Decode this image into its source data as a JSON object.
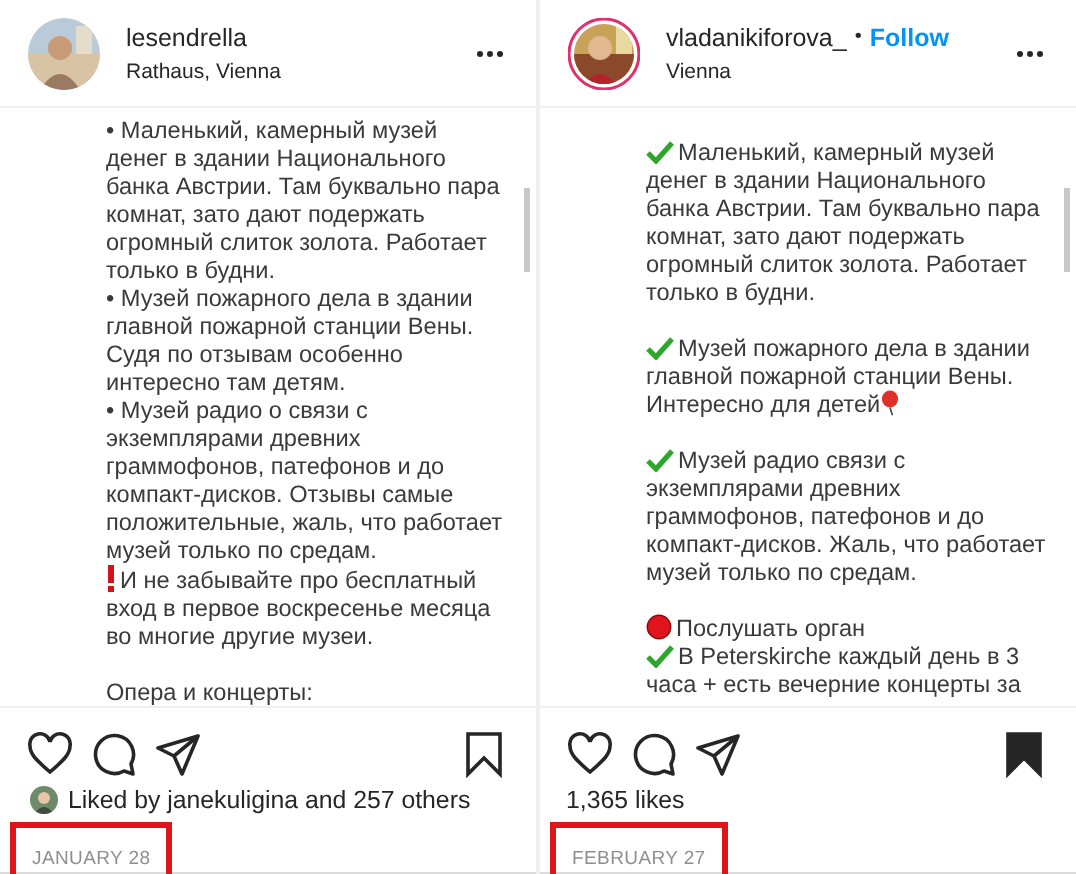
{
  "posts": [
    {
      "username": "lesendrella",
      "location": "Rathaus, Vienna",
      "saved": false,
      "liked_by": "Liked by janekuligina and 257 others",
      "date": "JANUARY 28",
      "date_highlighted": true,
      "caption": [
        [
          {
            "kind": "plain",
            "lines": [
              "• Маленький, камерный музей",
              "денег в здании Национального",
              "банка Австрии. Там буквально пара",
              "комнат, зато дают подержать",
              "огромный слиток золота. Работает",
              "только в будни."
            ]
          },
          {
            "kind": "plain",
            "lines": [
              "• Музей пожарного дела в здании",
              "главной пожарной станции Вены.",
              "Судя по отзывам особенно",
              "интересно там детям."
            ]
          },
          {
            "kind": "plain",
            "lines": [
              "• Музей радио о связи с",
              "экземплярами древних",
              "граммофонов, патефонов и до",
              "компакт-дисков. Отзывы самые",
              "положительные, жаль, что работает",
              "музей только по средам."
            ]
          },
          {
            "kind": "exclamation",
            "lines": [
              "И не забывайте про бесплатный",
              "вход в первое воскресенье месяца",
              "во многие другие музеи."
            ]
          }
        ],
        [
          {
            "kind": "plain",
            "lines": [
              "Опера и концерты:"
            ]
          }
        ]
      ]
    },
    {
      "username": "vladanikiforova_",
      "follow_separator": "•",
      "follow": "Follow",
      "location": "Vienna",
      "saved": true,
      "likes": "1,365 likes",
      "date": "FEBRUARY 27",
      "date_highlighted": true,
      "caption": [
        [
          {
            "kind": "check",
            "lines": [
              "Маленький, камерный музей",
              "денег в здании Национального",
              "банка Австрии. Там буквально пара",
              "комнат, зато дают подержать",
              "огромный слиток золота. Работает",
              "только в будни."
            ]
          }
        ],
        [
          {
            "kind": "check_balloon",
            "lines": [
              "Музей пожарного дела в здании",
              "главной пожарной станции Вены.",
              "Интересно для детей"
            ]
          }
        ],
        [
          {
            "kind": "check",
            "lines": [
              "Музей радио связи с",
              "экземплярами древних",
              "граммофонов, патефонов и до",
              "компакт-дисков. Жаль, что работает",
              "музей только по средам."
            ]
          }
        ],
        [
          {
            "kind": "circle",
            "lines": [
              "Послушать орган"
            ]
          },
          {
            "kind": "check",
            "lines": [
              "В Peterskirche каждый день в 3",
              "часа + есть вечерние концерты за"
            ]
          }
        ]
      ]
    }
  ]
}
